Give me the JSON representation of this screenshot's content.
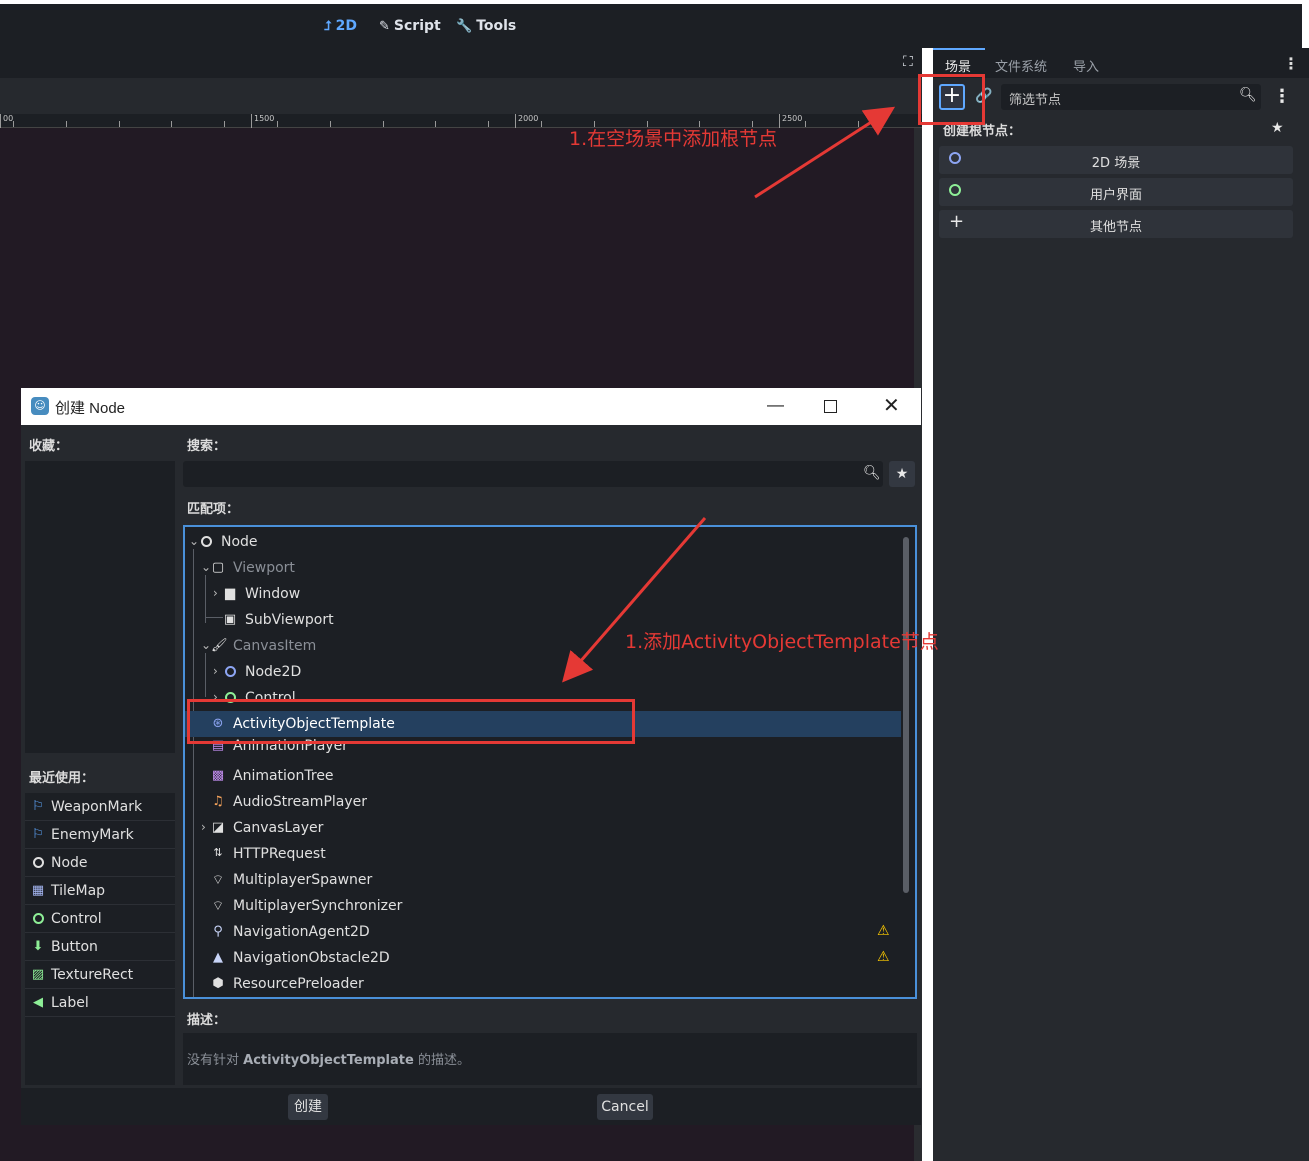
{
  "topbar": {
    "workspaces": {
      "2d": "2D",
      "script": "Script",
      "tools": "Tools"
    }
  },
  "ruler": {
    "labels": [
      "00",
      "1500",
      "2000",
      "2500"
    ]
  },
  "dock": {
    "tabs": {
      "scene": "场景",
      "filesystem": "文件系统",
      "import": "导入"
    },
    "filter_placeholder": "筛选节点",
    "create_root_label": "创建根节点：",
    "root_buttons": {
      "scene2d": "2D 场景",
      "ui": "用户界面",
      "other": "其他节点"
    }
  },
  "annotations": {
    "add_root": "1.在空场景中添加根节点",
    "add_template": "1.添加ActivityObjectTemplate节点"
  },
  "dialog": {
    "title": "创建 Node",
    "favorites_label": "收藏：",
    "search_label": "搜索：",
    "matches_label": "匹配项：",
    "recent_label": "最近使用：",
    "description_label": "描述：",
    "description": {
      "prefix": "没有针对 ",
      "name": "ActivityObjectTemplate",
      "suffix": " 的描述。"
    },
    "create_button": "创建",
    "cancel_button": "Cancel",
    "recent": [
      "WeaponMark",
      "EnemyMark",
      "Node",
      "TileMap",
      "Control",
      "Button",
      "TextureRect",
      "Label"
    ],
    "tree": [
      "Node",
      "Viewport",
      "Window",
      "SubViewport",
      "CanvasItem",
      "Node2D",
      "Control",
      "ActivityObjectTemplate",
      "AnimationPlayer",
      "AnimationTree",
      "AudioStreamPlayer",
      "CanvasLayer",
      "HTTPRequest",
      "MultiplayerSpawner",
      "MultiplayerSynchronizer",
      "NavigationAgent2D",
      "NavigationObstacle2D",
      "ResourcePreloader"
    ]
  },
  "colors": {
    "accent": "#5fa8ff",
    "annotation": "#e53935",
    "node2d": "#8da5f3",
    "control": "#8eef97",
    "warning": "#ffcc00"
  }
}
